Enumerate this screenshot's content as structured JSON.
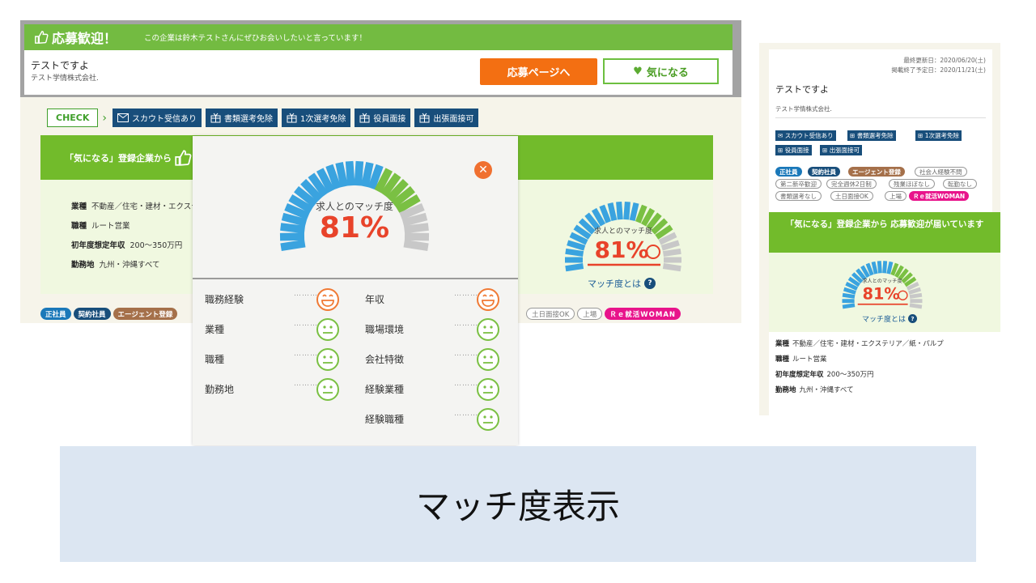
{
  "banner": {
    "title": "応募歓迎！",
    "message": "この企業は鈴木テストさんにぜひお会いしたいと言っています！"
  },
  "job": {
    "title": "テストですよ",
    "company": "テスト学情株式会社."
  },
  "buttons": {
    "apply": "応募ページへ",
    "favorite": "気になる",
    "favorite_icon": "heart-icon"
  },
  "check_label": "CHECK",
  "check_tags": [
    {
      "icon": "mail-icon",
      "label": "スカウト受信あり"
    },
    {
      "icon": "gift-icon",
      "label": "書類選考免除"
    },
    {
      "icon": "gift-icon",
      "label": "1次選考免除"
    },
    {
      "icon": "gift-icon",
      "label": "役員面接"
    },
    {
      "icon": "gift-icon",
      "label": "出張面接可"
    }
  ],
  "favorite_banner": "「気になる」登録企業から",
  "job_info": [
    {
      "label": "業種",
      "value": "不動産／住宅・建材・エクステ"
    },
    {
      "label": "職種",
      "value": "ルート営業"
    },
    {
      "label": "初年度想定年収",
      "value": "200〜350万円"
    },
    {
      "label": "勤務地",
      "value": "九州・沖縄すべて"
    }
  ],
  "chips_main": [
    "正社員",
    "契約社員",
    "エージェント登録",
    "土日面接OK",
    "上場",
    "Ｒｅ就活WOMAN"
  ],
  "match": {
    "label": "求人とのマッチ度",
    "percent": "81%",
    "value": 81,
    "link": "マッチ度とは"
  },
  "criteria_left": [
    {
      "label": "職務経験",
      "face": "laughing-face-icon"
    },
    {
      "label": "業種",
      "face": "neutral-face-icon"
    },
    {
      "label": "職種",
      "face": "neutral-face-icon"
    },
    {
      "label": "勤務地",
      "face": "neutral-face-icon"
    }
  ],
  "criteria_right": [
    {
      "label": "年収",
      "face": "laughing-face-icon"
    },
    {
      "label": "職場環境",
      "face": "neutral-face-icon"
    },
    {
      "label": "会社特徴",
      "face": "neutral-face-icon"
    },
    {
      "label": "経験業種",
      "face": "neutral-face-icon"
    },
    {
      "label": "経験職種",
      "face": "neutral-face-icon"
    }
  ],
  "criteria_dots": "………",
  "right_panel": {
    "updated": "最終更新日：2020/06/20(土)",
    "expires": "掲載終了予定日：2020/11/21(土)",
    "title": "テストですよ",
    "company": "テスト学情株式会社.",
    "tags": [
      "スカウト受信あり",
      "書類選考免除",
      "1次選考免除",
      "役員面接",
      "出張面接可"
    ],
    "chips": [
      "正社員",
      "契約社員",
      "エージェント登録",
      "社会人経験不問",
      "第二新卒歓迎",
      "完全週休2日制",
      "残業ほぼなし",
      "転勤なし",
      "書類選考なし",
      "土日面接OK",
      "上場",
      "Ｒｅ就活WOMAN"
    ],
    "banner": "「気になる」登録企業から 応募歓迎が届いています",
    "info": [
      {
        "label": "業種",
        "value": "不動産／住宅・建材・エクステリア／紙・パルプ"
      },
      {
        "label": "職種",
        "value": "ルート営業"
      },
      {
        "label": "初年度想定年収",
        "value": "200〜350万円"
      },
      {
        "label": "勤務地",
        "value": "九州・沖縄すべて"
      }
    ]
  },
  "caption": "マッチ度表示",
  "colors": {
    "green": "#72bb2b",
    "orange": "#f36f12",
    "navy": "#184e7b",
    "gauge_blue": "#3aa3df",
    "gauge_green": "#7ac043",
    "gauge_gray": "#c8c8c8",
    "match_red": "#e8432a"
  }
}
